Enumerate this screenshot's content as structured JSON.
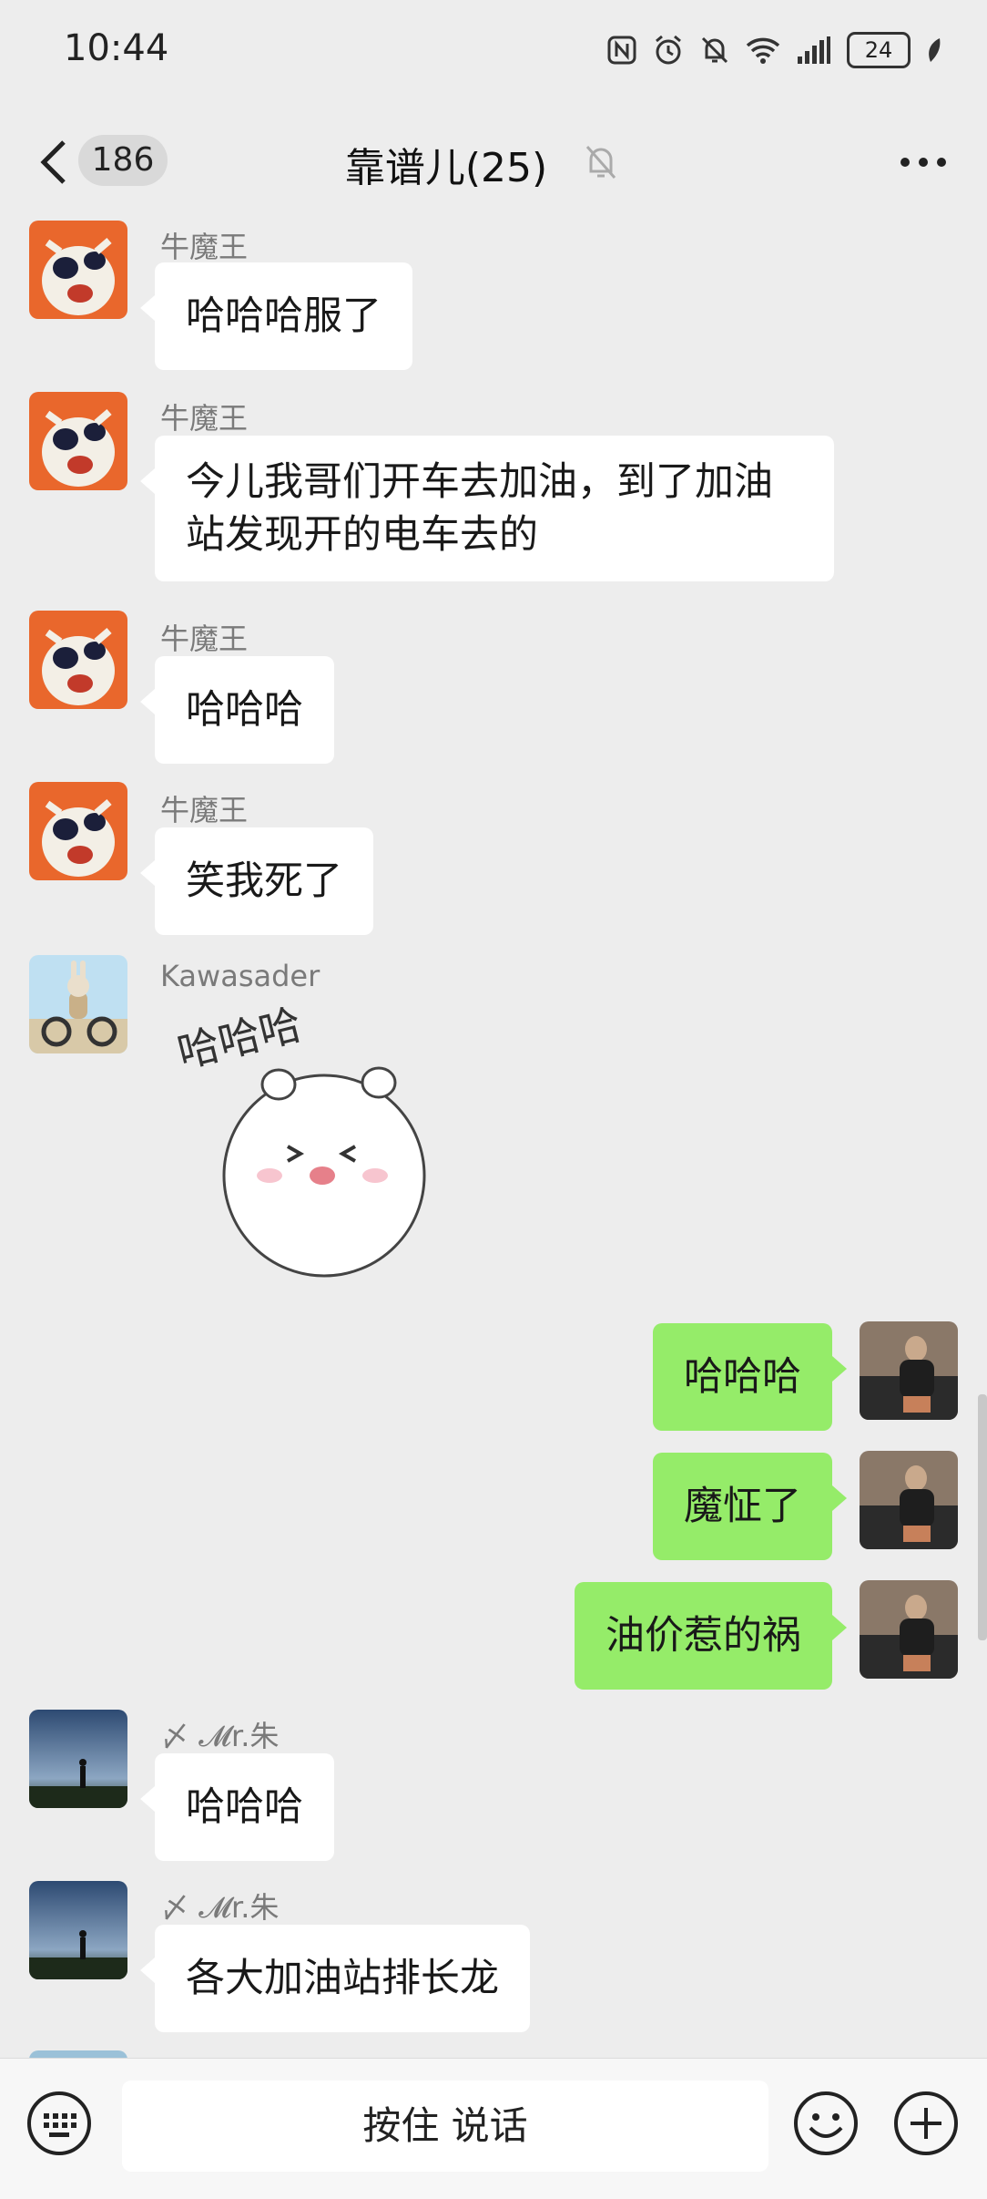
{
  "status_bar": {
    "time": "10:44",
    "battery": "24"
  },
  "nav": {
    "unread_count": "186",
    "title": "靠谱儿(25)"
  },
  "messages": [
    {
      "sender": "牛魔王",
      "text": "哈哈哈服了"
    },
    {
      "sender": "牛魔王",
      "text_line1": "今儿我哥们开车去加油，到了加油",
      "text_line2": "站发现开的电车去的"
    },
    {
      "sender": "牛魔王",
      "text": "哈哈哈"
    },
    {
      "sender": "牛魔王",
      "text": "笑我死了"
    },
    {
      "sender": "Kawasader",
      "sticker_text": "哈哈哈"
    },
    {
      "sender": "me",
      "text": "哈哈哈"
    },
    {
      "sender": "me",
      "text": "魔怔了"
    },
    {
      "sender": "me",
      "text": "油价惹的祸"
    },
    {
      "sender": "〆 𝓜r.朱",
      "text": "哈哈哈"
    },
    {
      "sender": "〆 𝓜r.朱",
      "text": "各大加油站排长龙"
    }
  ],
  "input": {
    "voice_label": "按住 说话"
  },
  "icons": {
    "back": "chevron-left-icon",
    "mute": "bell-off-icon",
    "more": "more-dots-icon",
    "keyboard": "keyboard-icon",
    "emoji": "emoji-icon",
    "plus": "plus-icon"
  },
  "colors": {
    "background": "#ededed",
    "incoming_bubble": "#ffffff",
    "outgoing_bubble": "#95ec69"
  }
}
